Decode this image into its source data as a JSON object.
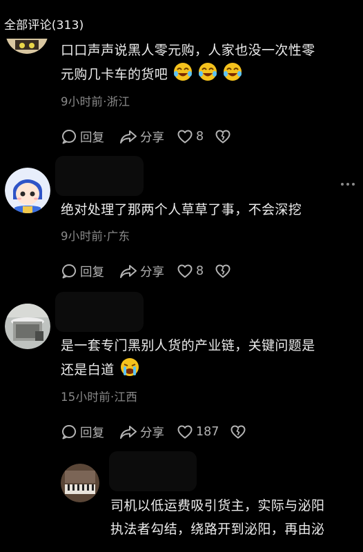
{
  "header": {
    "title": "全部评论(313)"
  },
  "comments": [
    {
      "text_lines": [
        "口口声声说黑人零元购，人家也没一次性零",
        "元购几卡车的货吧"
      ],
      "emojis": [
        "laugh-cry",
        "laugh-cry",
        "laugh-cry"
      ],
      "meta": "9小时前·浙江",
      "reply_label": "回复",
      "share_label": "分享",
      "likes": "8"
    },
    {
      "text_lines": [
        "绝对处理了那两个人草草了事，不会深挖"
      ],
      "meta": "9小时前·广东",
      "reply_label": "回复",
      "share_label": "分享",
      "likes": "8"
    },
    {
      "text_lines": [
        "是一套专门黑别人货的产业链，关键问题是",
        "还是白道"
      ],
      "emojis": [
        "crying"
      ],
      "meta": "15小时前·江西",
      "reply_label": "回复",
      "share_label": "分享",
      "likes": "187"
    }
  ],
  "reply": {
    "text_lines": [
      "司机以低运费吸引货主，实际与泌阳",
      "执法者勾结，绕路开到泌阳，再由泌"
    ]
  }
}
